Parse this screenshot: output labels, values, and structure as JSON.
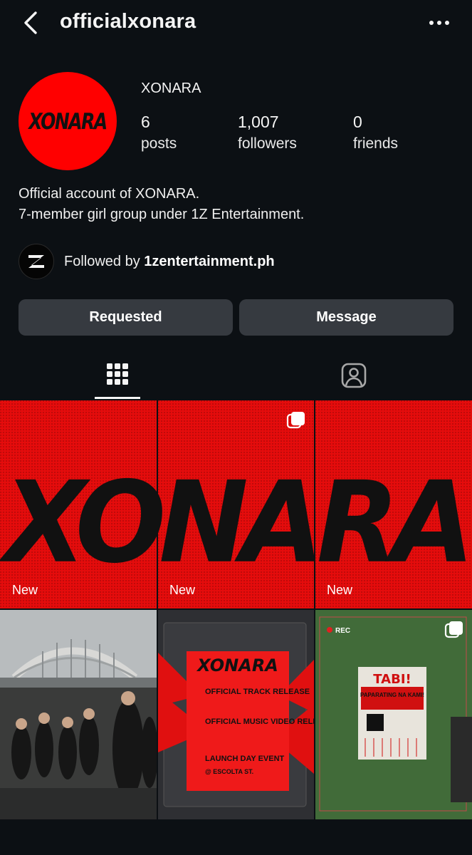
{
  "header": {
    "username": "officialxonara",
    "back_icon": "chevron-left-icon",
    "more_icon": "more-horizontal-icon"
  },
  "profile": {
    "avatar_text": "XONARA",
    "display_name": "XONARA",
    "stats": [
      {
        "value": "6",
        "label": "posts"
      },
      {
        "value": "1,007",
        "label": "followers"
      },
      {
        "value": "0",
        "label": "friends"
      }
    ],
    "bio_lines": [
      "Official account of XONARA.",
      "7-member girl group under 1Z Entertainment."
    ],
    "followed_by_prefix": "Followed by ",
    "followed_by_account": "1zentertainment.ph"
  },
  "actions": {
    "requested_label": "Requested",
    "message_label": "Message"
  },
  "tabs": [
    {
      "name": "grid",
      "icon": "grid-icon",
      "active": true
    },
    {
      "name": "tagged",
      "icon": "tagged-person-icon",
      "active": false
    }
  ],
  "posts": {
    "banner_text": "XONARA",
    "new_label": "New",
    "schedule_title": "XONARA",
    "schedule_items": [
      "OFFICIAL TRACK RELEASE",
      "OFFICIAL MUSIC VIDEO RELEASE",
      "LAUNCH DAY EVENT",
      "@ ESCOLTA ST."
    ],
    "poster_title": "TABI!",
    "poster_sub": "PAPARATING NA KAMI!",
    "rec_label": "REC"
  },
  "colors": {
    "background": "#0c1014",
    "button_bg": "#363a40",
    "brand_red": "#e50c0c"
  }
}
